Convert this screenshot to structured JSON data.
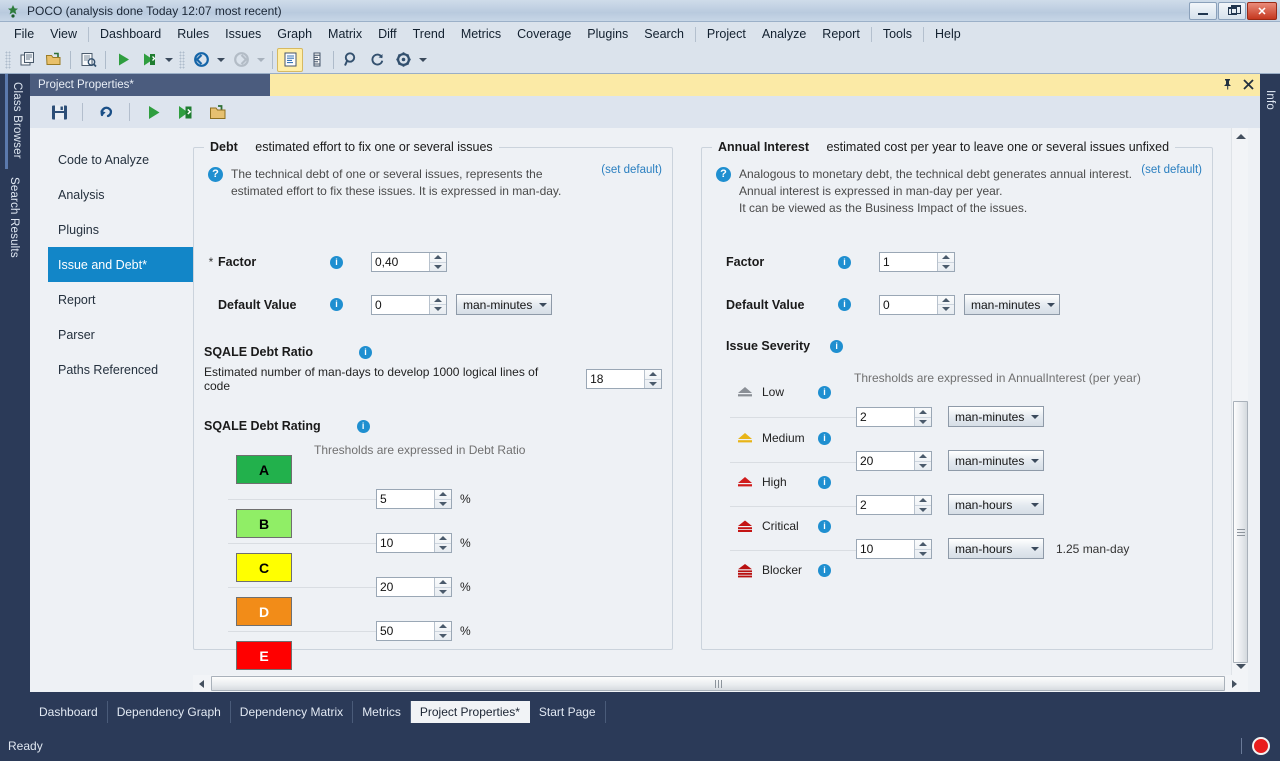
{
  "window": {
    "title": "POCO  (analysis done Today 12:07 most recent)",
    "app_icon": "ndepend-icon",
    "minimize_label": "",
    "maximize_label": "",
    "close_label": "✕"
  },
  "menubar": {
    "items": [
      "File",
      "View",
      "Dashboard",
      "Rules",
      "Issues",
      "Graph",
      "Matrix",
      "Diff",
      "Trend",
      "Metrics",
      "Coverage",
      "Plugins",
      "Search",
      "Project",
      "Analyze",
      "Report",
      "Tools",
      "Help"
    ]
  },
  "toolbar": {
    "buttons": [
      "copy-project-icon",
      "open-project-icon",
      "project-properties-icon",
      "run-analysis-icon",
      "run-analysis-options-icon",
      "back-icon",
      "forward-icon",
      "report-icon",
      "ruler-icon",
      "search-icon",
      "refresh-icon",
      "settings-icon"
    ]
  },
  "left_dock": {
    "tabs": [
      "Class Browser",
      "Search Results"
    ]
  },
  "right_dock": {
    "tabs": [
      "Info"
    ]
  },
  "document": {
    "tab_label": "Project Properties*",
    "pin_icon": "pin-icon",
    "close_icon": "close-icon",
    "toolbar_buttons": [
      "save-icon",
      "undo-icon",
      "run-icon",
      "run-and-close-icon",
      "export-icon"
    ]
  },
  "nav": {
    "items": [
      {
        "label": "Code to Analyze",
        "selected": false
      },
      {
        "label": "Analysis",
        "selected": false
      },
      {
        "label": "Plugins",
        "selected": false
      },
      {
        "label": "Issue and Debt*",
        "selected": true
      },
      {
        "label": "Report",
        "selected": false
      },
      {
        "label": "Parser",
        "selected": false
      },
      {
        "label": "Paths Referenced",
        "selected": false
      }
    ]
  },
  "debt": {
    "title": "Debt",
    "subtitle": "estimated effort to fix one or several issues",
    "set_default": "(set default)",
    "help_lines": [
      "The technical debt of one or several issues, represents the",
      "estimated effort to fix these issues. It is expressed in man-day."
    ],
    "factor": {
      "star": "*",
      "label": "Factor",
      "value": "0,40"
    },
    "default_value": {
      "label": "Default Value",
      "value": "0",
      "unit": "man-minutes"
    },
    "debt_ratio": {
      "title": "SQALE Debt Ratio",
      "description": "Estimated number of man-days to develop 1000 logical lines of code",
      "value": "18"
    },
    "debt_rating": {
      "title": "SQALE Debt Rating",
      "threshold_note": "Thresholds are expressed in Debt Ratio",
      "grades": [
        {
          "letter": "A",
          "color": "#22b14c",
          "text_color": "#000000"
        },
        {
          "letter": "B",
          "color": "#90ee66",
          "text_color": "#000000"
        },
        {
          "letter": "C",
          "color": "#ffff00",
          "text_color": "#000000"
        },
        {
          "letter": "D",
          "color": "#f28c18",
          "text_color": "#ffffff"
        },
        {
          "letter": "E",
          "color": "#ff0000",
          "text_color": "#ffffff"
        }
      ],
      "thresholds": [
        {
          "value": "5",
          "unit": "%"
        },
        {
          "value": "10",
          "unit": "%"
        },
        {
          "value": "20",
          "unit": "%"
        },
        {
          "value": "50",
          "unit": "%"
        }
      ]
    }
  },
  "annual_interest": {
    "title": "Annual Interest",
    "subtitle": "estimated cost per year to leave one or several issues unfixed",
    "set_default": "(set default)",
    "help_lines": [
      "Analogous to monetary debt, the technical debt generates annual interest.",
      "Annual interest is expressed in man-day per year.",
      "It can be viewed as the Business Impact of the issues."
    ],
    "factor": {
      "label": "Factor",
      "value": "1"
    },
    "default_value": {
      "label": "Default Value",
      "value": "0",
      "unit": "man-minutes"
    },
    "issue_severity": {
      "title": "Issue Severity",
      "threshold_note": "Thresholds are expressed in AnnualInterest (per year)",
      "levels": [
        {
          "label": "Low",
          "color": "#8a8f96",
          "icon": "severity-low-icon"
        },
        {
          "label": "Medium",
          "color": "#e8b417",
          "icon": "severity-medium-icon"
        },
        {
          "label": "High",
          "color": "#d01c1c",
          "icon": "severity-high-icon"
        },
        {
          "label": "Critical",
          "color": "#c41414",
          "icon": "severity-critical-icon"
        },
        {
          "label": "Blocker",
          "color": "#b81010",
          "icon": "severity-blocker-icon"
        }
      ],
      "thresholds": [
        {
          "value": "2",
          "unit": "man-minutes",
          "note": ""
        },
        {
          "value": "20",
          "unit": "man-minutes",
          "note": ""
        },
        {
          "value": "2",
          "unit": "man-hours",
          "note": ""
        },
        {
          "value": "10",
          "unit": "man-hours",
          "note": "1.25 man-day"
        }
      ]
    }
  },
  "bottom_tabs": {
    "items": [
      {
        "label": "Dashboard",
        "selected": false
      },
      {
        "label": "Dependency Graph",
        "selected": false
      },
      {
        "label": "Dependency Matrix",
        "selected": false
      },
      {
        "label": "Metrics",
        "selected": false
      },
      {
        "label": "Project Properties*",
        "selected": true
      },
      {
        "label": "Start Page",
        "selected": false
      }
    ]
  },
  "status": {
    "text": "Ready",
    "record_indicator": "record-icon"
  },
  "colors": {
    "accent": "#1286c8",
    "chrome_dark": "#2b3a58",
    "doc_title": "#4b5c7e",
    "highlight_yellow": "#fbeaa6",
    "link": "#2a7fc0"
  }
}
